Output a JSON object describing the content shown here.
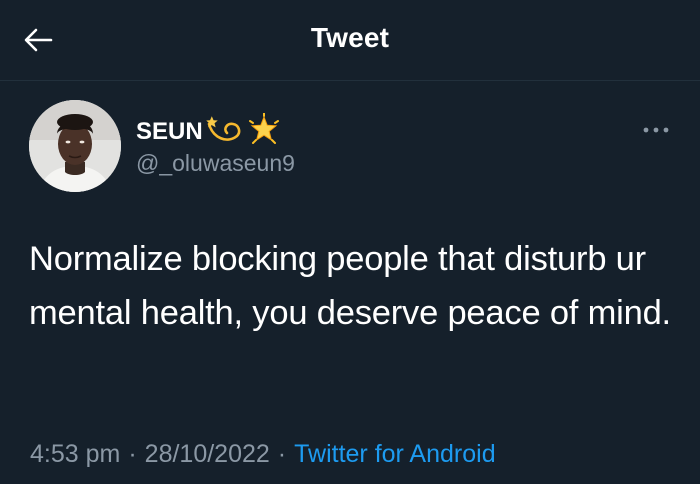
{
  "header": {
    "title": "Tweet",
    "back_icon": "arrow-left-icon"
  },
  "tweet": {
    "author": {
      "display_name": "SEUN",
      "handle": "@_oluwaseun9",
      "emojis": [
        "dizzy-star-emoji",
        "glowing-star-emoji"
      ]
    },
    "more_icon": "ellipsis-icon",
    "text": "Normalize blocking people that disturb ur mental health, you deserve peace of mind.",
    "time": "4:53 pm",
    "date": "28/10/2022",
    "separator": "·",
    "source": "Twitter for Android"
  },
  "colors": {
    "background": "#15202b",
    "text": "#ffffff",
    "secondary": "#8b98a5",
    "link": "#1d9bf0"
  }
}
